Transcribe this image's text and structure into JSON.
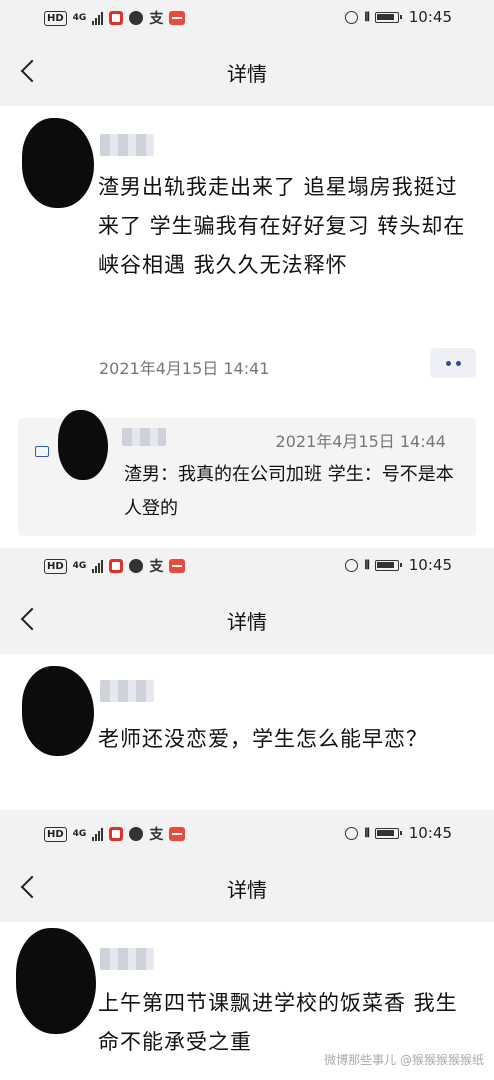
{
  "status_bar": {
    "hd": "HD",
    "network": "4G",
    "network_sub": "+",
    "app_icon_text": "支",
    "time": "10:45"
  },
  "nav": {
    "title": "详情"
  },
  "panel1": {
    "post_text": "渣男出轨我走出来了 追星塌房我挺过来了 学生骗我有在好好复习 转头却在峡谷相遇 我久久无法释怀",
    "post_date": "2021年4月15日 14:41",
    "reply": {
      "date": "2021年4月15日 14:44",
      "text": "渣男：我真的在公司加班 学生：号不是本人登的"
    }
  },
  "panel2": {
    "post_text": "老师还没恋爱，学生怎么能早恋？"
  },
  "panel3": {
    "post_text": "上午第四节课飘进学校的饭菜香 我生命不能承受之重"
  },
  "watermark": "微博那些事儿 @猴猴猴猴猴纸"
}
